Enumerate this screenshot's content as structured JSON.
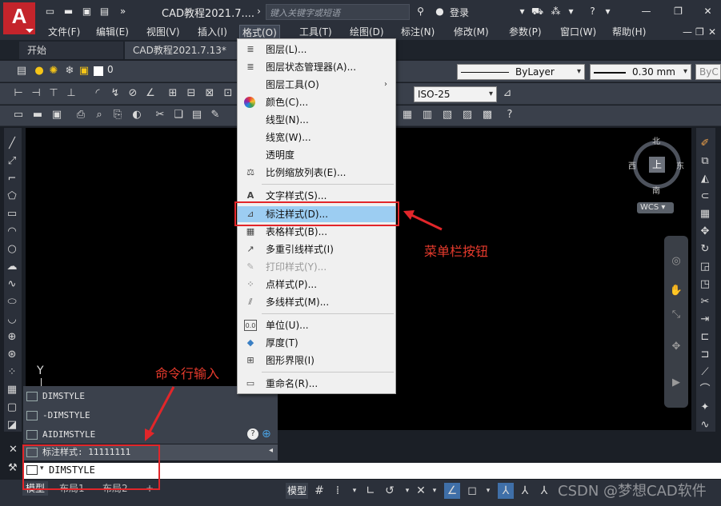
{
  "app": {
    "logo_letter": "A",
    "title": "CAD教程2021.7....",
    "search_placeholder": "键入关键字或短语",
    "login": "登录"
  },
  "menubar": [
    "文件(F)",
    "编辑(E)",
    "视图(V)",
    "插入(I)",
    "格式(O)",
    "工具(T)",
    "绘图(D)",
    "标注(N)",
    "修改(M)",
    "参数(P)",
    "窗口(W)",
    "帮助(H)"
  ],
  "tabs": {
    "start": "开始",
    "doc": "CAD教程2021.7.13*"
  },
  "toolbar": {
    "layer_value": "0",
    "linetype": "ByLayer",
    "lineweight": "0.30 mm",
    "plotstyle": "ByC",
    "dimstyle": "ISO-25"
  },
  "compass": {
    "north": "北",
    "south": "南",
    "east": "东",
    "west": "西",
    "center": "上",
    "wcs": "WCS"
  },
  "dropdown": [
    {
      "label": "图层(L)...",
      "icon": "layers-icon"
    },
    {
      "label": "图层状态管理器(A)...",
      "icon": "layer-state-icon"
    },
    {
      "label": "图层工具(O)",
      "icon": "",
      "submenu": true
    },
    {
      "label": "颜色(C)...",
      "icon": "color-wheel-icon"
    },
    {
      "label": "线型(N)...",
      "icon": ""
    },
    {
      "label": "线宽(W)...",
      "icon": ""
    },
    {
      "label": "透明度",
      "icon": ""
    },
    {
      "label": "比例缩放列表(E)...",
      "icon": "scale-icon"
    },
    {
      "label": "文字样式(S)...",
      "icon": "text-style-icon"
    },
    {
      "label": "标注样式(D)...",
      "icon": "dim-style-icon",
      "highlighted": true
    },
    {
      "label": "表格样式(B)...",
      "icon": "table-style-icon"
    },
    {
      "label": "多重引线样式(I)",
      "icon": "mleader-icon"
    },
    {
      "label": "打印样式(Y)...",
      "icon": "plot-style-icon",
      "disabled": true
    },
    {
      "label": "点样式(P)...",
      "icon": "point-style-icon"
    },
    {
      "label": "多线样式(M)...",
      "icon": "mline-icon"
    },
    {
      "label": "单位(U)...",
      "icon": "units-icon"
    },
    {
      "label": "厚度(T)",
      "icon": "thickness-icon"
    },
    {
      "label": "图形界限(I)",
      "icon": "limits-icon"
    },
    {
      "label": "重命名(R)...",
      "icon": "rename-icon"
    }
  ],
  "annotations": {
    "menu_button": "菜单栏按钮",
    "command_input": "命令行输入"
  },
  "command": {
    "history": [
      "DIMSTYLE",
      "-DIMSTYLE",
      "AIDIMSTYLE"
    ],
    "status": "标注样式: 11111111",
    "input": "DIMSTYLE"
  },
  "axis_label": "Y",
  "statusbar": {
    "model_tab": "模型",
    "layout1": "布局1",
    "layout2": "布局2",
    "add": "+",
    "model_btn": "模型"
  },
  "watermark": "CSDN @梦想CAD软件"
}
